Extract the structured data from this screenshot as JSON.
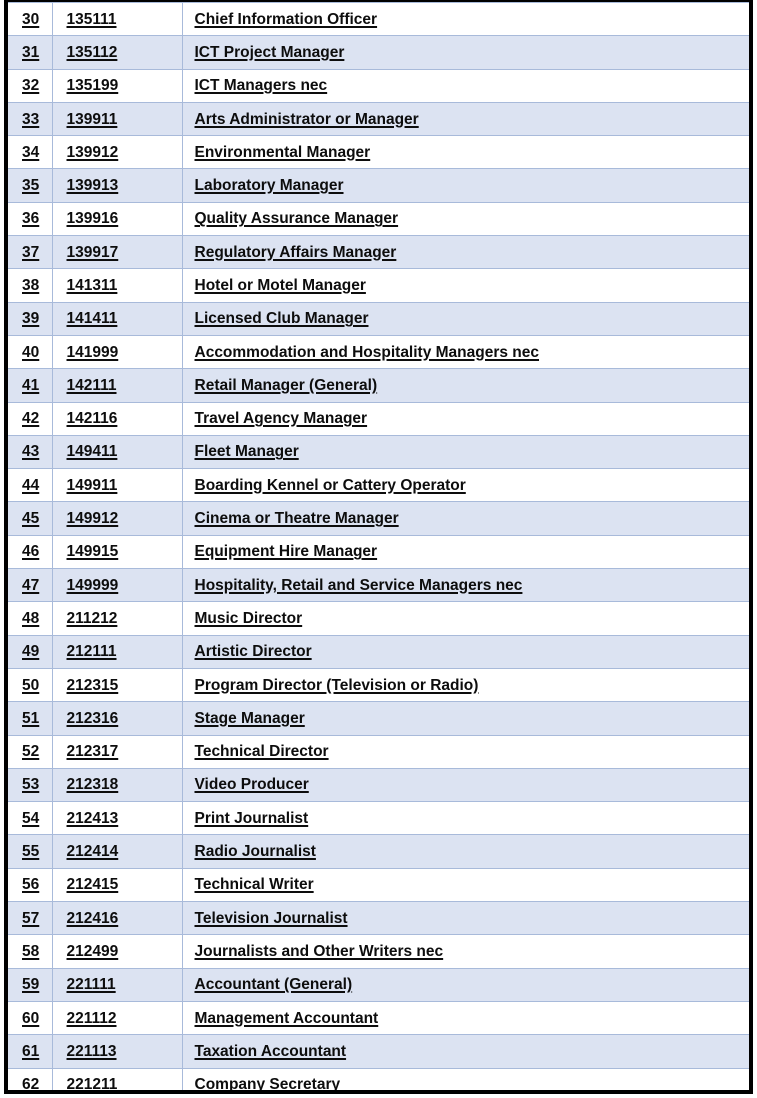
{
  "document": {
    "kind": "occupation-code-table",
    "description": "Numbered list of occupations with six-digit occupation codes",
    "colors": {
      "band_row_background": "#dce3f2",
      "plain_row_background": "#ffffff",
      "cell_border": "#a8bada",
      "outer_frame": "#000000",
      "text": "#0d0d0d"
    },
    "columns": [
      {
        "key": "num",
        "name": "row-number"
      },
      {
        "key": "code",
        "name": "occupation-code"
      },
      {
        "key": "title",
        "name": "occupation-title"
      }
    ],
    "rows": [
      {
        "num": "30",
        "code": "135111",
        "title": "Chief Information Officer"
      },
      {
        "num": "31",
        "code": "135112",
        "title": "ICT Project Manager"
      },
      {
        "num": "32",
        "code": "135199",
        "title": "ICT Managers nec"
      },
      {
        "num": "33",
        "code": "139911",
        "title": "Arts Administrator or Manager"
      },
      {
        "num": "34",
        "code": "139912",
        "title": "Environmental Manager"
      },
      {
        "num": "35",
        "code": "139913",
        "title": "Laboratory Manager"
      },
      {
        "num": "36",
        "code": "139916",
        "title": "Quality Assurance Manager"
      },
      {
        "num": "37",
        "code": "139917",
        "title": "Regulatory Affairs Manager"
      },
      {
        "num": "38",
        "code": "141311",
        "title": "Hotel or Motel Manager"
      },
      {
        "num": "39",
        "code": "141411",
        "title": "Licensed Club Manager"
      },
      {
        "num": "40",
        "code": "141999",
        "title": "Accommodation and Hospitality Managers nec"
      },
      {
        "num": "41",
        "code": "142111",
        "title": "Retail Manager (General)"
      },
      {
        "num": "42",
        "code": "142116",
        "title": "Travel Agency Manager"
      },
      {
        "num": "43",
        "code": "149411",
        "title": "Fleet Manager"
      },
      {
        "num": "44",
        "code": "149911",
        "title": "Boarding Kennel or Cattery Operator"
      },
      {
        "num": "45",
        "code": "149912",
        "title": "Cinema or Theatre Manager"
      },
      {
        "num": "46",
        "code": "149915",
        "title": "Equipment Hire Manager"
      },
      {
        "num": "47",
        "code": "149999",
        "title": "Hospitality, Retail and Service Managers nec"
      },
      {
        "num": "48",
        "code": "211212",
        "title": "Music Director"
      },
      {
        "num": "49",
        "code": "212111",
        "title": "Artistic Director"
      },
      {
        "num": "50",
        "code": "212315",
        "title": "Program Director (Television or Radio)"
      },
      {
        "num": "51",
        "code": "212316",
        "title": "Stage Manager"
      },
      {
        "num": "52",
        "code": "212317",
        "title": "Technical Director"
      },
      {
        "num": "53",
        "code": "212318",
        "title": "Video Producer"
      },
      {
        "num": "54",
        "code": "212413",
        "title": "Print Journalist"
      },
      {
        "num": "55",
        "code": "212414",
        "title": "Radio Journalist"
      },
      {
        "num": "56",
        "code": "212415",
        "title": "Technical Writer"
      },
      {
        "num": "57",
        "code": "212416",
        "title": "Television Journalist"
      },
      {
        "num": "58",
        "code": "212499",
        "title": "Journalists and Other Writers nec"
      },
      {
        "num": "59",
        "code": "221111",
        "title": "Accountant (General)"
      },
      {
        "num": "60",
        "code": "221112",
        "title": "Management Accountant"
      },
      {
        "num": "61",
        "code": "221113",
        "title": "Taxation Accountant"
      },
      {
        "num": "62",
        "code": "221211",
        "title": "Company Secretary"
      }
    ]
  }
}
